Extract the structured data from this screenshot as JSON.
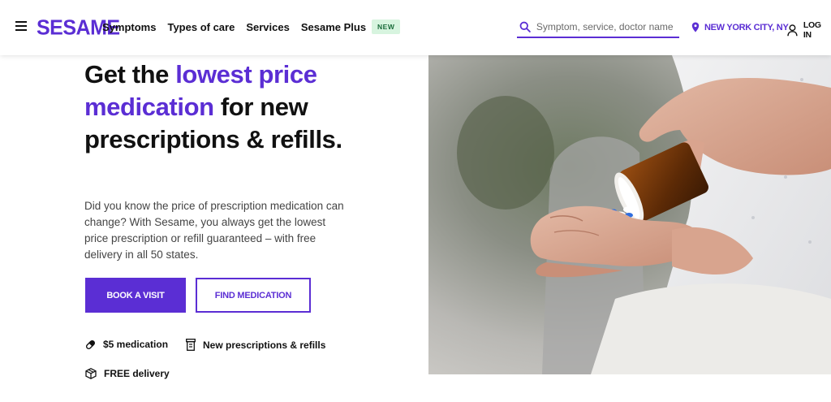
{
  "header": {
    "logo": "SESAME",
    "nav": [
      "Symptoms",
      "Types of care",
      "Services",
      "Sesame Plus"
    ],
    "badge": "NEW",
    "search_placeholder": "Symptom, service, doctor name",
    "location": "NEW YORK CITY, NY",
    "login": "LOG IN"
  },
  "hero": {
    "title_part1": "Get the ",
    "title_accent": "lowest price medication",
    "title_part2": " for new prescriptions & refills.",
    "description": "Did you know the price of prescription medication can change? With Sesame, you always get the lowest price prescription or refill guaranteed – with free delivery in all 50 states.",
    "primary_button": "BOOK A VISIT",
    "secondary_button": "FIND MEDICATION"
  },
  "features": [
    {
      "icon": "pill-icon",
      "label": "$5 medication"
    },
    {
      "icon": "prescription-bottle-icon",
      "label": "New prescriptions & refills"
    },
    {
      "icon": "package-icon",
      "label": "FREE delivery"
    }
  ],
  "colors": {
    "brand": "#5b2ed4",
    "badge_bg": "#d7f4df",
    "badge_text": "#1a6b3a"
  },
  "photo": {
    "icon": "hands-pouring-pills-photo"
  }
}
